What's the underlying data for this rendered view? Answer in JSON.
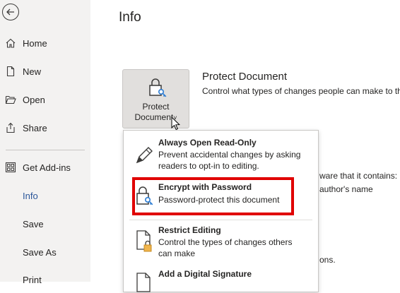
{
  "nav": {
    "items": [
      {
        "label": "Home",
        "icon": "home-icon"
      },
      {
        "label": "New",
        "icon": "new-document-icon"
      },
      {
        "label": "Open",
        "icon": "folder-open-icon"
      },
      {
        "label": "Share",
        "icon": "share-icon"
      },
      {
        "label": "Get Add-ins",
        "icon": "add-ins-grid-icon"
      },
      {
        "label": "Info",
        "active": true
      },
      {
        "label": "Save"
      },
      {
        "label": "Save As"
      },
      {
        "label": "Print"
      }
    ]
  },
  "main": {
    "title": "Info",
    "protect_button": {
      "line1": "Protect",
      "line2": "Document",
      "caret": "˅"
    },
    "protect_section": {
      "title": "Protect Document",
      "description": "Control what types of changes people can make to th"
    },
    "background_fragments": {
      "inspect_line": "ware that it contains:",
      "author_line": "author's name",
      "versions_line": "ons."
    }
  },
  "menu": {
    "items": [
      {
        "title": "Always Open Read-Only",
        "desc": "Prevent accidental changes by asking readers to opt-in to editing.",
        "icon": "pencil-no-edit-icon"
      },
      {
        "title": "Encrypt with Password",
        "desc": "Password-protect this document",
        "icon": "lock-key-icon"
      },
      {
        "title": "Restrict Editing",
        "desc": "Control the types of changes others can make",
        "icon": "document-lock-icon"
      },
      {
        "title": "Add a Digital Signature",
        "desc": "",
        "icon": "signature-document-icon"
      }
    ]
  },
  "colors": {
    "highlight": "#e00000",
    "accent": "#2b579a",
    "nav_bg": "#f3f2f1"
  }
}
